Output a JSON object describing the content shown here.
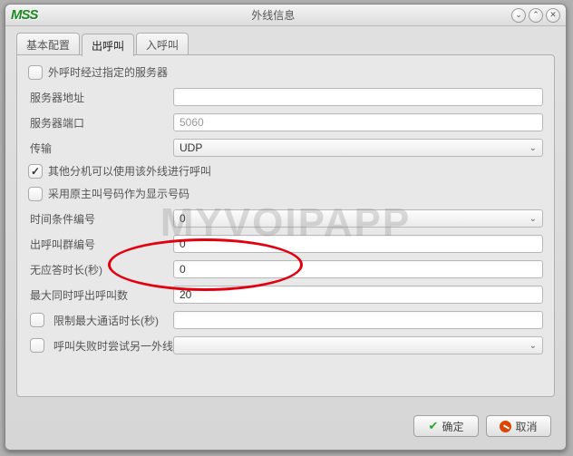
{
  "window": {
    "app_icon_text": "MSS",
    "title": "外线信息"
  },
  "tabs": {
    "basic": "基本配置",
    "outcall": "出呼叫",
    "incall": "入呼叫"
  },
  "form": {
    "via_server_label": "外呼时经过指定的服务器",
    "server_addr_label": "服务器地址",
    "server_addr_value": "",
    "server_port_label": "服务器端口",
    "server_port_placeholder": "5060",
    "server_port_value": "",
    "transport_label": "传输",
    "transport_value": "UDP",
    "allow_other_ext_label": "其他分机可以使用该外线进行呼叫",
    "use_original_caller_label": "采用原主叫号码作为显示号码",
    "time_cond_label": "时间条件编号",
    "time_cond_value": "0",
    "outcall_group_label": "出呼叫群编号",
    "outcall_group_value": "0",
    "no_answer_label": "无应答时长(秒)",
    "no_answer_value": "0",
    "max_concurrent_label": "最大同时呼出呼叫数",
    "max_concurrent_value": "20",
    "limit_max_talk_label": "限制最大通话时长(秒)",
    "limit_max_talk_value": "",
    "fail_try_other_label": "呼叫失败时尝试另一外线",
    "fail_try_other_value": ""
  },
  "checks": {
    "via_server": false,
    "allow_other_ext": true,
    "use_original_caller": false,
    "limit_max_talk": false,
    "fail_try_other": false
  },
  "buttons": {
    "ok": "确定",
    "cancel": "取消"
  },
  "watermark": "MYVOIPAPP"
}
